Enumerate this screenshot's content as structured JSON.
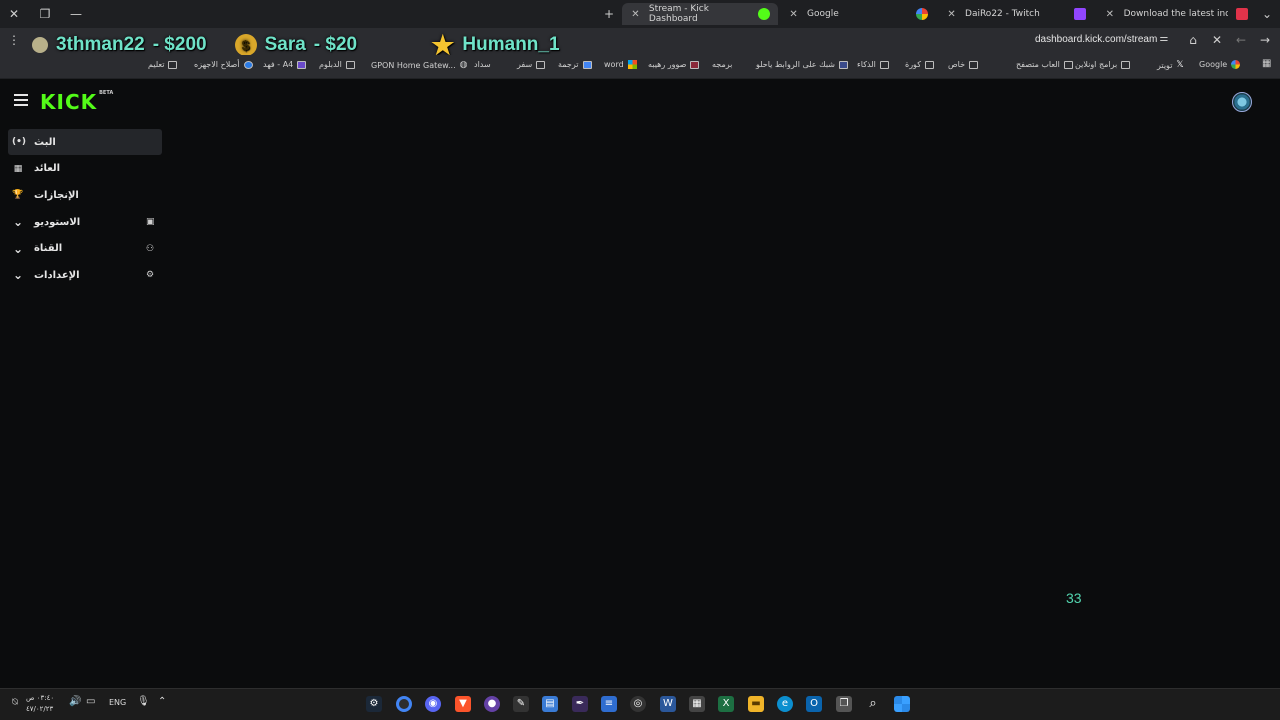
{
  "window": {
    "tabs": [
      {
        "label": "Stream - Kick Dashboard",
        "active": true
      },
      {
        "label": "Google",
        "active": false
      },
      {
        "label": "DaiRo22 - Twitch",
        "active": false
      },
      {
        "label": "Download the latest indie gam",
        "active": false
      }
    ],
    "new_tab": "+",
    "url": "dashboard.kick.com/stream"
  },
  "ticker": {
    "d1_name": "3thman22",
    "d1_amount": "- $200",
    "d2_name": "Sara",
    "d2_amount": "- $20",
    "d3_name": "Humann_1",
    "coin_symbol": "$"
  },
  "bookmarks": [
    {
      "label": "Google"
    },
    {
      "label": "تويتر"
    },
    {
      "label": "برامج اونلاين"
    },
    {
      "label": "العاب متصفح"
    },
    {
      "label": "خاص"
    },
    {
      "label": "كورة"
    },
    {
      "label": "الذكاء"
    },
    {
      "label": "شبك على الروابط ياحلو"
    },
    {
      "label": "برمجه"
    },
    {
      "label": "صوور رهيبه"
    },
    {
      "label": "word"
    },
    {
      "label": "ترجمة"
    },
    {
      "label": "سفر"
    },
    {
      "label": "سداد"
    },
    {
      "label": "GPON Home Gatew..."
    },
    {
      "label": "الدبلوم"
    },
    {
      "label": "فهد - A4"
    },
    {
      "label": "أصلاح الاجهزه"
    },
    {
      "label": "تعليم"
    }
  ],
  "app": {
    "logo": "KICK",
    "logo_badge": "BETA",
    "nav": [
      {
        "label": "البث",
        "icon": "(•)"
      },
      {
        "label": "العائد",
        "icon": "▦"
      },
      {
        "label": "الإنجازات",
        "icon": "🏆"
      },
      {
        "label": "الاستوديو",
        "icon": "⌄",
        "ricon": "▣"
      },
      {
        "label": "القناة",
        "icon": "⌄",
        "ricon": "⚇"
      },
      {
        "label": "الإعدادات",
        "icon": "⌄",
        "ricon": "⚙"
      }
    ],
    "counter": "33"
  },
  "taskbar": {
    "lang": "ENG",
    "time": "٠٣:٤٠ ص",
    "date": "٤٧/٠٢/٢٣"
  },
  "colors": {
    "brand": "#53fc18",
    "ticker_text": "#6fe3c8",
    "background": "#0b0c0d"
  }
}
